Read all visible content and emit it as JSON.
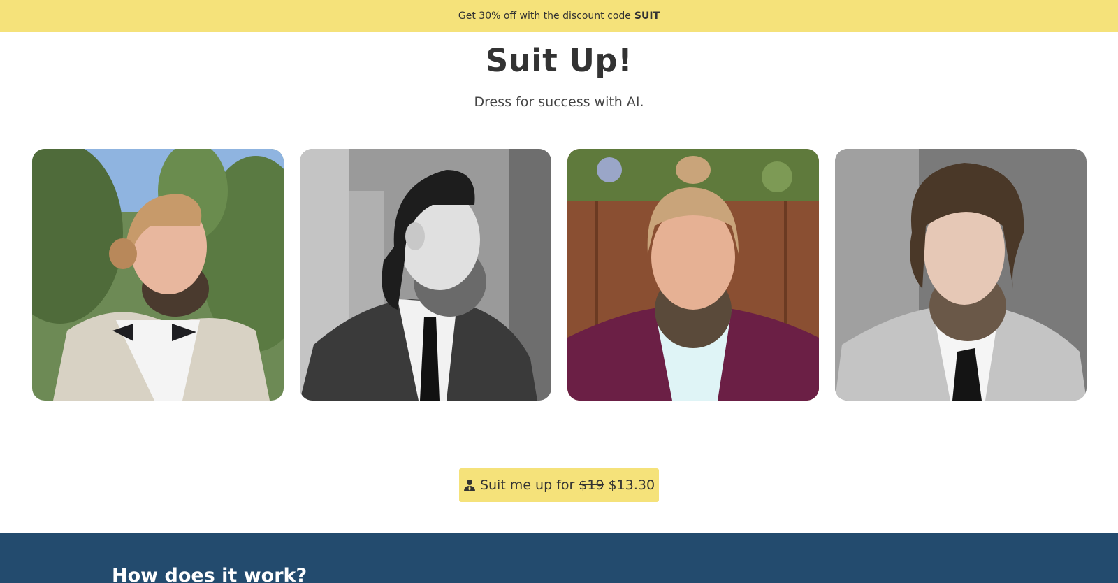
{
  "promo": {
    "text": "Get 30% off with the discount code",
    "code": "SUIT"
  },
  "hero": {
    "title": "Suit Up!",
    "subtitle": "Dress for success with AI."
  },
  "gallery": {
    "photos": [
      {
        "label": "Portrait in beige suit with bow tie, trees background"
      },
      {
        "label": "Black and white portrait in dark suit and tie"
      },
      {
        "label": "Portrait in burgundy suit, wooden fence background"
      },
      {
        "label": "Portrait in grey suit with black tie"
      }
    ]
  },
  "cta": {
    "prefix": "Suit me up for",
    "old_price": "$19",
    "new_price": "$13.30",
    "icon": "user-tie-icon"
  },
  "how": {
    "title": "How does it work?"
  },
  "colors": {
    "accent_yellow": "#f5e27a",
    "section_blue": "#234b6e",
    "text_dark": "#333333"
  }
}
